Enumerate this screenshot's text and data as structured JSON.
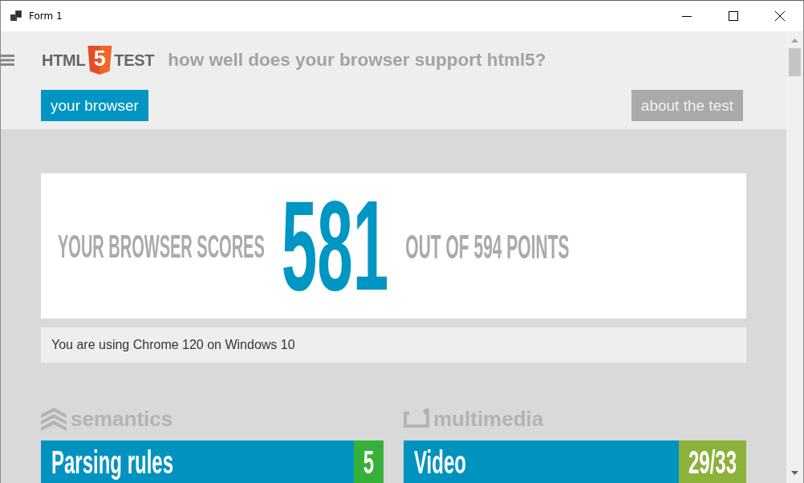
{
  "window": {
    "title": "Form 1"
  },
  "header": {
    "logo": {
      "left": "HTML",
      "badge": "5",
      "right": "TEST"
    },
    "tagline": "how well does your browser support html5?"
  },
  "nav": [
    {
      "label": "your browser",
      "selected": true
    },
    {
      "label": "about the test",
      "selected": false
    }
  ],
  "score": {
    "prefix": "YOUR BROWSER SCORES",
    "value": "581",
    "suffix": "OUT OF 594 POINTS"
  },
  "info": "You are using Chrome 120 on Windows 10",
  "sections": [
    {
      "title": "semantics",
      "kind": "semantics",
      "categories": [
        {
          "name": "Parsing rules",
          "score": "5",
          "color": "#37b03a"
        }
      ]
    },
    {
      "title": "multimedia",
      "kind": "multimedia",
      "categories": [
        {
          "name": "Video",
          "score": "29/33",
          "color": "#8cb23b"
        }
      ]
    }
  ]
}
